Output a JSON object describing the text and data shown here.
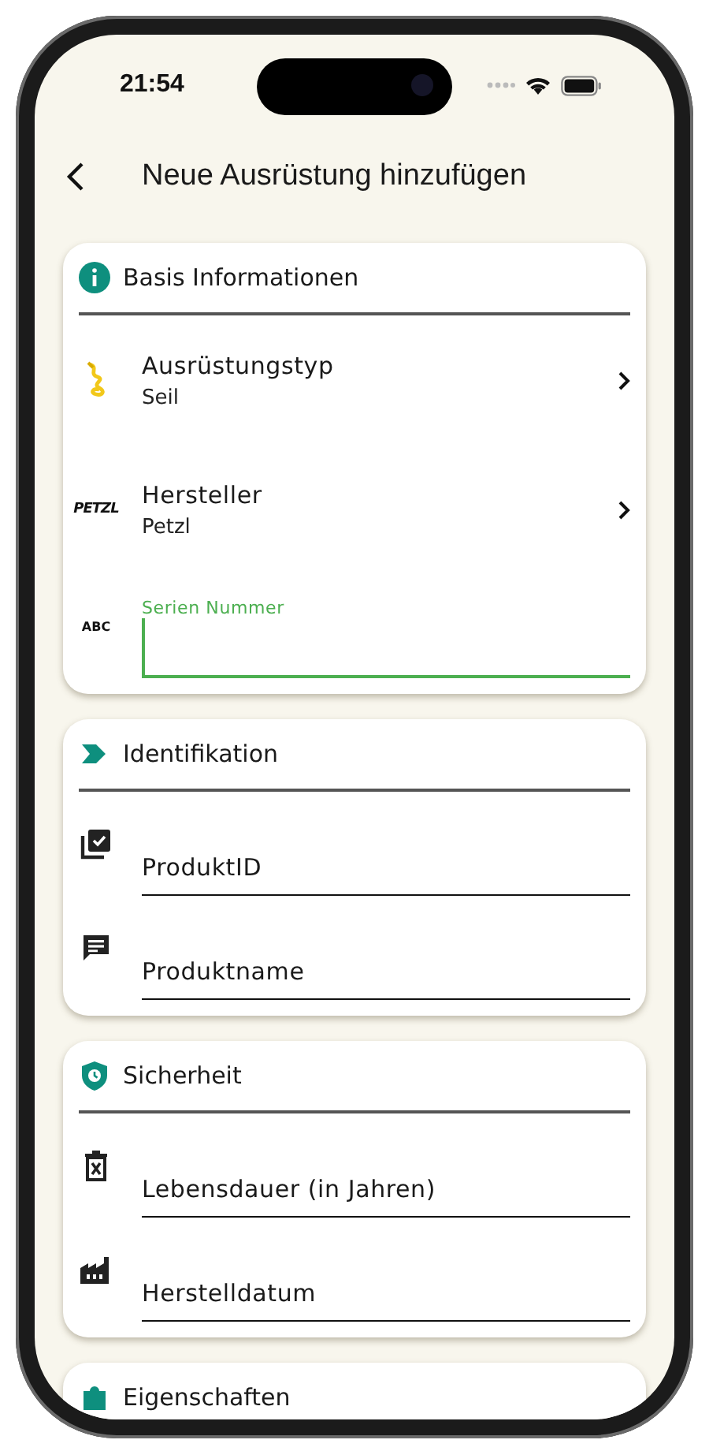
{
  "status_bar": {
    "time": "21:54"
  },
  "header": {
    "title": "Neue Ausrüstung hinzufügen"
  },
  "sections": [
    {
      "title": "Basis Informationen",
      "rows": [
        {
          "kind": "picker",
          "label": "Ausrüstungstyp",
          "value": "Seil"
        },
        {
          "kind": "picker",
          "label": "Hersteller",
          "value": "Petzl",
          "icon_text": "PETZL"
        },
        {
          "kind": "text_field",
          "label": "Serien Nummer",
          "focused": true,
          "icon_text": "ABC"
        }
      ]
    },
    {
      "title": "Identifikation",
      "rows": [
        {
          "kind": "text_field",
          "placeholder": "ProduktID",
          "focused": false
        },
        {
          "kind": "text_field",
          "placeholder": "Produktname",
          "focused": false
        }
      ]
    },
    {
      "title": "Sicherheit",
      "rows": [
        {
          "kind": "text_field",
          "placeholder": "Lebensdauer (in Jahren)",
          "focused": false
        },
        {
          "kind": "text_field",
          "placeholder": "Herstelldatum",
          "focused": false
        }
      ]
    },
    {
      "title": "Eigenschaften"
    }
  ]
}
